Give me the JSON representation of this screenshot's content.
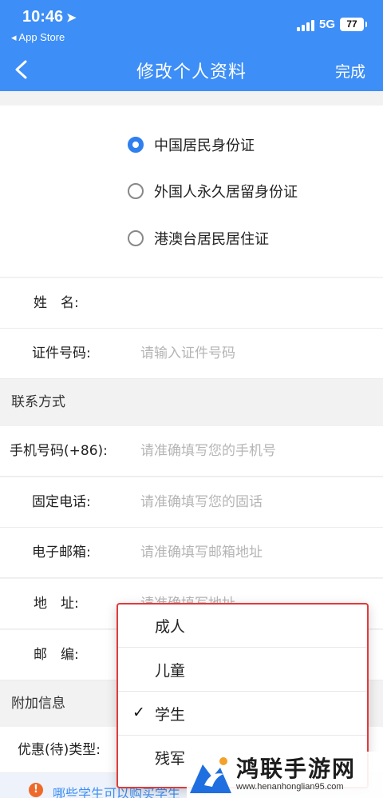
{
  "status_bar": {
    "time": "10:46",
    "back_app": "◂ App Store",
    "network": "5G",
    "battery": "77"
  },
  "nav": {
    "title": "修改个人资料",
    "done": "完成"
  },
  "id_types": [
    {
      "label": "中国居民身份证",
      "selected": true
    },
    {
      "label": "外国人永久居留身份证",
      "selected": false
    },
    {
      "label": "港澳台居民居住证",
      "selected": false
    }
  ],
  "fields": {
    "name": {
      "label": "姓　名:",
      "value": ""
    },
    "id_number": {
      "label": "证件号码:",
      "placeholder": "请输入证件号码"
    }
  },
  "contact": {
    "heading": "联系方式",
    "mobile": {
      "label": "手机号码(+86):",
      "placeholder": "请准确填写您的手机号"
    },
    "landline": {
      "label": "固定电话:",
      "placeholder": "请准确填写您的固话"
    },
    "email": {
      "label": "电子邮箱:",
      "placeholder": "请准确填写邮箱地址"
    },
    "address": {
      "label": "地　址:",
      "placeholder": "请准确填写地址"
    },
    "postcode": {
      "label": "邮　编:",
      "placeholder": ""
    }
  },
  "extra": {
    "heading": "附加信息",
    "discount_type": {
      "label": "优惠(待)类型:"
    }
  },
  "tip": {
    "text": "哪些学生可以购买学生"
  },
  "dropdown": {
    "options": [
      {
        "label": "成人",
        "selected": false
      },
      {
        "label": "儿童",
        "selected": false
      },
      {
        "label": "学生",
        "selected": true
      },
      {
        "label": "残军",
        "selected": false
      }
    ],
    "check_mark": "✓"
  },
  "watermark": {
    "title": "鸿联手游网",
    "url": "www.henanhonglian95.com"
  },
  "colors": {
    "brand_blue": "#3d8ef6",
    "radio_blue": "#2f7ff0",
    "dropdown_border": "#e23a3a",
    "tip_icon": "#ee6a2b"
  }
}
